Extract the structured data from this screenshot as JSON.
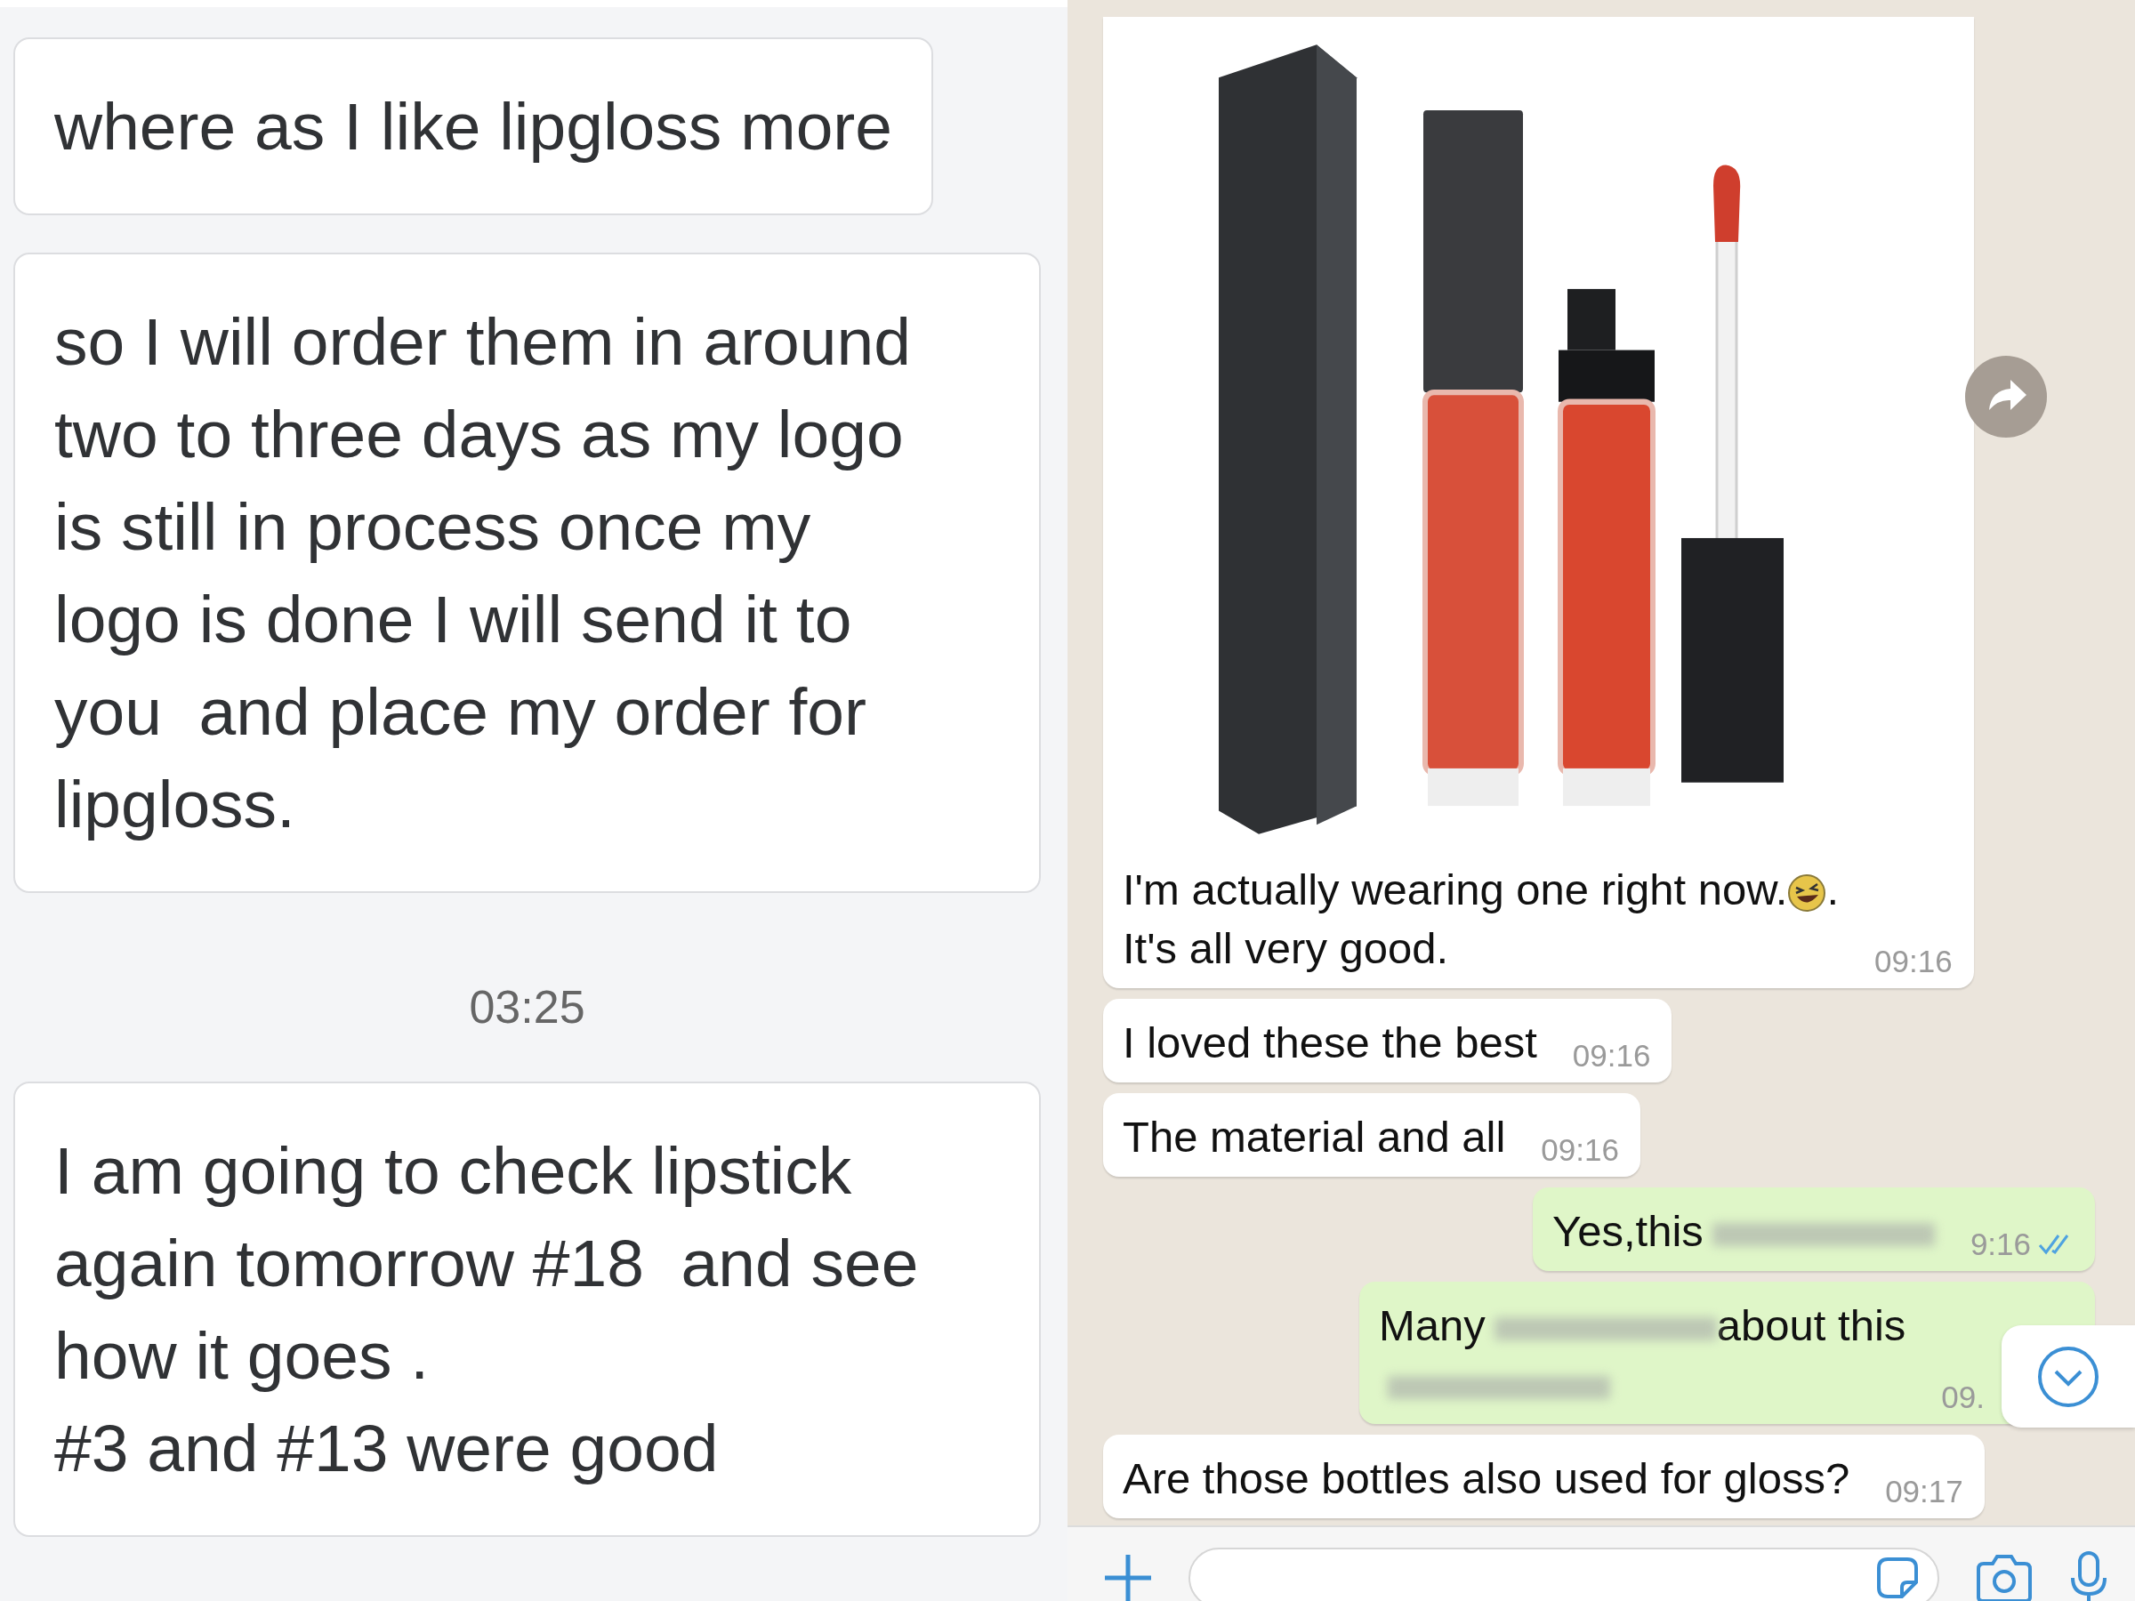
{
  "left_chat": {
    "messages": [
      {
        "kind": "message",
        "text": "where as I like lipgloss more"
      },
      {
        "kind": "message",
        "text": "so I will order them in around\ntwo to three days as my logo\nis still in process once my\nlogo is done I will send it to\nyou  and place my order for\nlipgloss."
      },
      {
        "kind": "timestamp",
        "text": "03:25"
      },
      {
        "kind": "message",
        "text": "I am going to check lipstick\nagain tomorrow #18  and see\nhow it goes .\n#3 and #13 were good"
      }
    ]
  },
  "right_chat": {
    "scroll_down_button": true,
    "messages": [
      {
        "kind": "photo",
        "outgoing": false,
        "forwardable": true,
        "segments": [
          {
            "kind": "text",
            "text": "I'm actually wearing one right now."
          },
          {
            "kind": "emoji"
          },
          {
            "kind": "text",
            "text": "."
          },
          {
            "kind": "break"
          },
          {
            "kind": "text",
            "text": "It's all very good."
          }
        ],
        "time": "09:16"
      },
      {
        "kind": "text",
        "outgoing": false,
        "segments": [
          {
            "kind": "text",
            "text": "I loved these the best"
          }
        ],
        "time": "09:16"
      },
      {
        "kind": "text",
        "outgoing": false,
        "segments": [
          {
            "kind": "text",
            "text": "The material and all"
          }
        ],
        "time": "09:16"
      },
      {
        "kind": "text",
        "outgoing": true,
        "segments": [
          {
            "kind": "text",
            "text": "Yes,this"
          },
          {
            "kind": "blur"
          }
        ],
        "time": "9:16",
        "read": true
      },
      {
        "kind": "text",
        "outgoing": true,
        "segments": [
          {
            "kind": "text",
            "text": "Many"
          },
          {
            "kind": "blur"
          },
          {
            "kind": "text",
            "text": "about this"
          },
          {
            "kind": "break"
          },
          {
            "kind": "blur"
          }
        ],
        "time": "09."
      },
      {
        "kind": "text",
        "outgoing": false,
        "segments": [
          {
            "kind": "text",
            "text": "Are those bottles also used for gloss?"
          }
        ],
        "time": "09:17"
      }
    ]
  }
}
